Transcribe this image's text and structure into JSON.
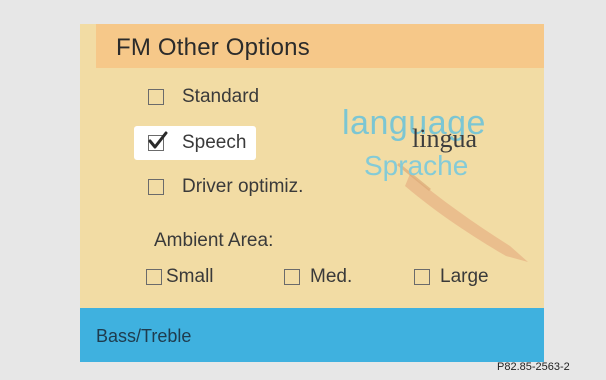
{
  "panel": {
    "title": "FM Other Options",
    "options": [
      {
        "label": "Standard",
        "checked": false
      },
      {
        "label": "Speech",
        "checked": true
      },
      {
        "label": "Driver optimiz.",
        "checked": false
      }
    ],
    "ambient_label": "Ambient Area:",
    "ambient_options": [
      {
        "label": "Small",
        "checked": false
      },
      {
        "label": "Med.",
        "checked": false
      },
      {
        "label": "Large",
        "checked": false
      }
    ],
    "bottom_item": "Bass/Treble"
  },
  "decor_words": [
    "language",
    "lingua",
    "Sprache"
  ],
  "figure_code": "P82.85-2563-2",
  "colors": {
    "panel_bg": "#f2dca4",
    "title_bar": "#f6c889",
    "bottom_bar": "#3fb1df",
    "outer_bg": "#e7e7e7"
  }
}
